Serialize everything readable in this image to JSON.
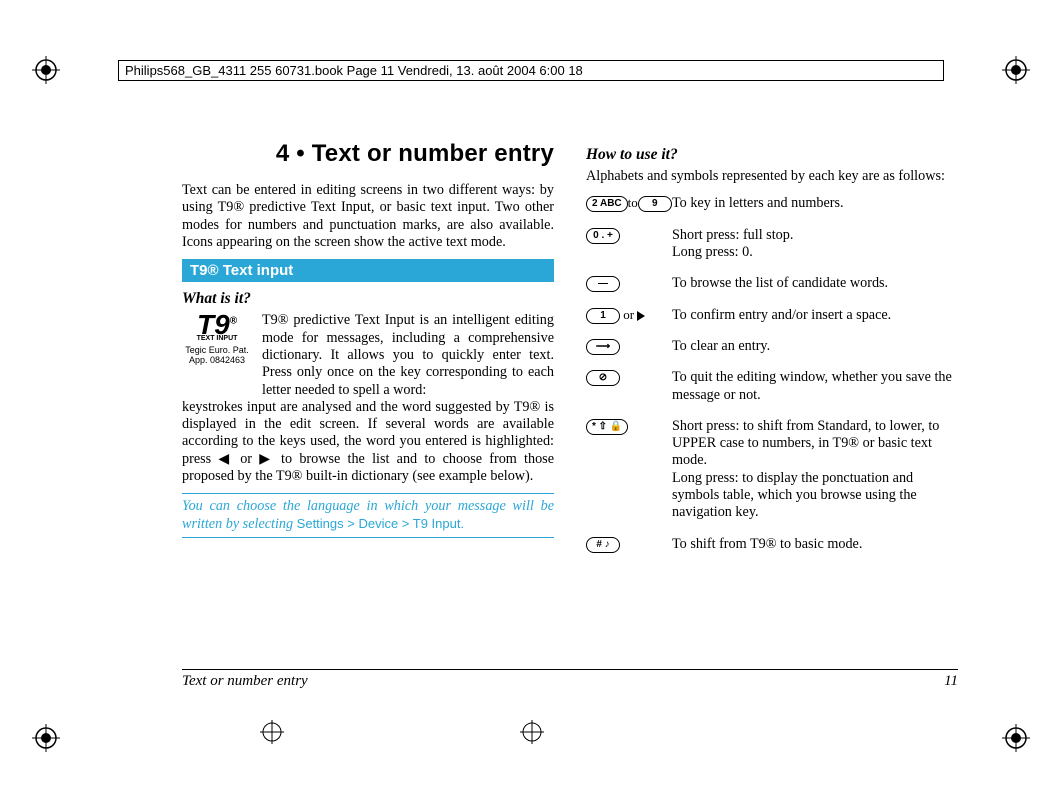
{
  "header": {
    "line": "Philips568_GB_4311 255 60731.book  Page 11  Vendredi, 13. août 2004  6:00 18"
  },
  "chapter": {
    "title": "4 • Text or number entry"
  },
  "intro": "Text can be entered in editing screens in two different ways: by using T9® predictive Text Input, or basic text input. Two other modes for numbers and punctuation marks, are also available. Icons appearing on the screen show the active text mode.",
  "section_bar": "T9® Text input",
  "what": {
    "heading": "What is it?",
    "logo_main": "T9",
    "logo_sub": "TEXT INPUT",
    "patent": "Tegic Euro. Pat. App. 0842463",
    "para_wrapped": "T9® predictive Text Input is an intelligent editing mode for messages, including a comprehensive dictionary. It allows you to quickly enter text. Press only once on the key corresponding to each letter needed to spell a word:",
    "para_rest": "keystrokes input are analysed and the word suggested by T9® is displayed in the edit screen. If several words are available according to the keys used, the word you entered is highlighted: press ◀ or ▶ to browse the list and to choose from those proposed by the T9® built-in dictionary (see example below)."
  },
  "tip": {
    "lead": "You can choose the language in which your message will be written by selecting ",
    "link": "Settings > Device > T9 Input."
  },
  "how": {
    "heading": "How to use it?",
    "intro": "Alphabets and symbols represented by each key are as follows:",
    "rows": [
      {
        "key_html": "2to9",
        "k1": "2 ABC",
        "mid": "to",
        "k2": "9",
        "desc": "To key in letters and numbers."
      },
      {
        "k1": "0 . +",
        "desc": "Short press: full stop.\nLong press: 0."
      },
      {
        "k1": "—",
        "desc": "To browse the list of candidate words."
      },
      {
        "k1": "1",
        "mid": "or",
        "tri": "right",
        "desc": "To confirm entry and/or insert a space."
      },
      {
        "k1": "⟶",
        "desc": "To clear an entry."
      },
      {
        "k1": "⊘",
        "desc": "To quit the editing window, whether you save the message or not."
      },
      {
        "k1": "* ⇧ 🔒",
        "desc": "Short press: to shift from Standard, to lower, to UPPER case to numbers, in T9® or basic text mode.\nLong press: to display the ponctuation and symbols table, which you browse using the navigation key."
      },
      {
        "k1": "# ♪",
        "desc": "To shift from T9® to basic mode."
      }
    ]
  },
  "footer": {
    "title": "Text or number entry",
    "page": "11"
  }
}
